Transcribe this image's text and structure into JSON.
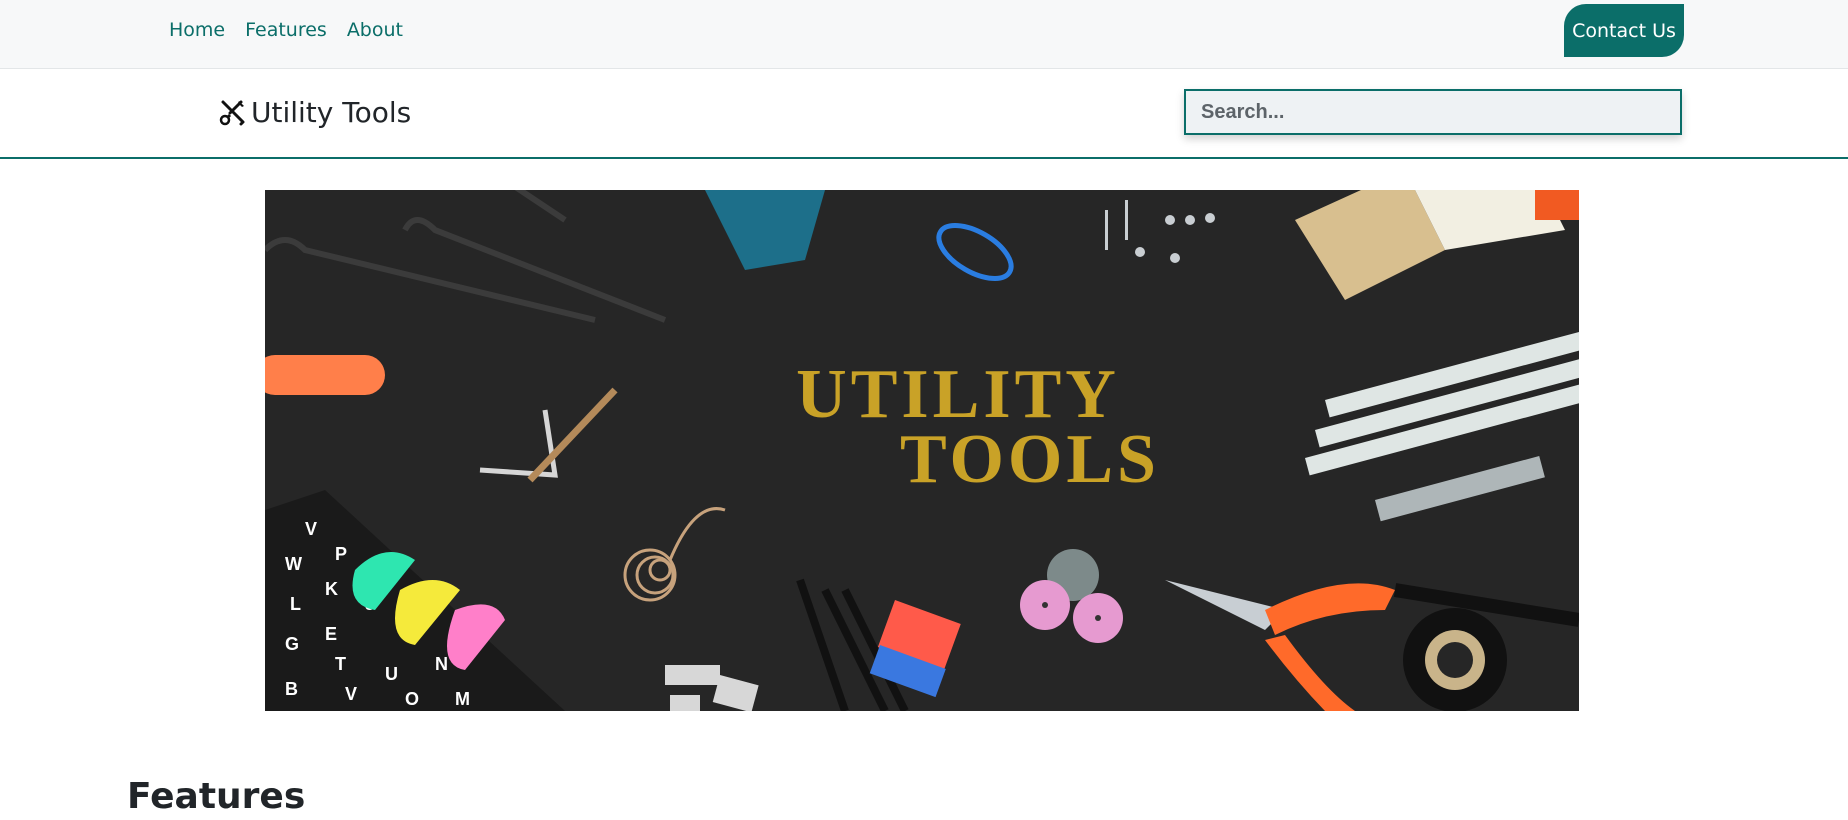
{
  "nav": {
    "links": [
      {
        "label": "Home"
      },
      {
        "label": "Features"
      },
      {
        "label": "About"
      }
    ],
    "contact_label": "Contact Us"
  },
  "header": {
    "brand_icon": "tools-icon",
    "brand_name": "Utility Tools",
    "search_placeholder": "Search..."
  },
  "hero": {
    "headline_line1": "UTILITY",
    "headline_line2": "TOOLS"
  },
  "sections": {
    "features_title": "Features"
  },
  "colors": {
    "accent": "#0b6e69",
    "nav_bg": "#f7f8f9",
    "hero_bg": "#262626",
    "hero_text": "#c9a227"
  }
}
